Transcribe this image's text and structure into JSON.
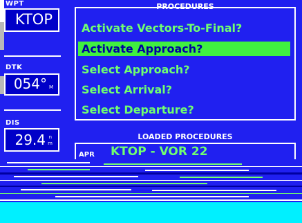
{
  "left_fields": {
    "wpt": {
      "label": "WPT",
      "value": "KTOP"
    },
    "dtk": {
      "label": "DTK",
      "value": "054°",
      "unit": "M"
    },
    "dis": {
      "label": "DIS",
      "value": "29.4",
      "unit_top": "n",
      "unit_bottom": "m"
    }
  },
  "procedures": {
    "title": "PROCEDURES",
    "items": [
      {
        "label": "Activate Vectors-To-Final?",
        "selected": false
      },
      {
        "label": "Activate Approach?",
        "selected": true
      },
      {
        "label": "Select Approach?",
        "selected": false
      },
      {
        "label": "Select Arrival?",
        "selected": false
      },
      {
        "label": "Select Departure?",
        "selected": false
      }
    ]
  },
  "loaded": {
    "title": "LOADED PROCEDURES",
    "type": "APR",
    "procedure": "KTOP - VOR 22"
  },
  "colors": {
    "background": "#2020f0",
    "text_green": "#70ff70",
    "highlight": "#40f040",
    "bottom_bar": "#00f0ff"
  }
}
